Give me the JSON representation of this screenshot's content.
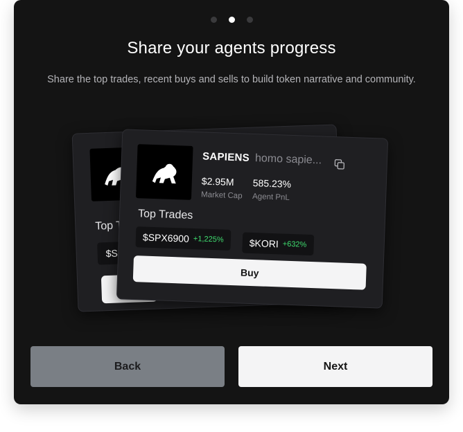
{
  "pager": {
    "total": 3,
    "active_index": 1
  },
  "header": {
    "title": "Share your agents progress",
    "subtitle": "Share the top trades, recent buys and sells to build token narrative and community."
  },
  "preview_card": {
    "token_name": "SAPIENS",
    "token_subtitle": "homo sapie...",
    "market_cap_value": "$2.95M",
    "market_cap_label": "Market Cap",
    "agent_pnl_value": "585.23%",
    "agent_pnl_label": "Agent PnL",
    "top_trades_label": "Top Trades",
    "trades": [
      {
        "ticker": "$SPX6900",
        "change": "+1,225%"
      },
      {
        "ticker": "$KORI",
        "change": "+632%"
      }
    ],
    "buy_label": "Buy"
  },
  "back_card": {
    "top_trades_label": "Top T",
    "chip_text": "$S"
  },
  "footer": {
    "back_label": "Back",
    "next_label": "Next"
  },
  "colors": {
    "modal_bg": "#141414",
    "card_bg": "#1f1f22",
    "positive": "#3fdc6f",
    "back_button": "#7a7f85",
    "next_button": "#f4f4f5"
  }
}
